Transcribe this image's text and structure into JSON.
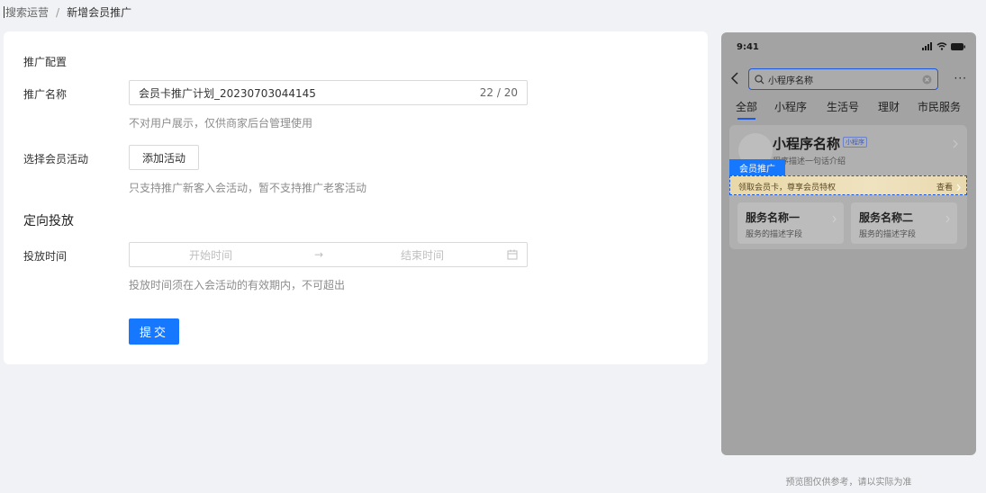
{
  "breadcrumb": {
    "prev": "搜索运营",
    "separator": "/",
    "current": "新增会员推广"
  },
  "form": {
    "section_title": "推广配置",
    "name_label": "推广名称",
    "name_value": "会员卡推广计划_20230703044145",
    "name_count": "22 / 20",
    "name_hint": "不对用户展示，仅供商家后台管理使用",
    "activity_label": "选择会员活动",
    "add_activity_button": "添加活动",
    "activity_hint": "只支持推广新客入会活动，暂不支持推广老客活动",
    "targeting_title": "定向投放",
    "time_label": "投放时间",
    "start_placeholder": "开始时间",
    "range_arrow": "→",
    "end_placeholder": "结束时间",
    "time_hint": "投放时间须在入会活动的有效期内，不可超出",
    "submit_button": "提交"
  },
  "preview": {
    "status_time": "9:41",
    "search_text": "小程序名称",
    "more": "···",
    "tabs": [
      "全部",
      "小程序",
      "生活号",
      "理财",
      "市民服务"
    ],
    "active_tab": 0,
    "mini_name": "小程序名称",
    "mini_tag": "小程序",
    "mini_desc": "程序描述一句话介绍",
    "promo_label": "会员推广",
    "promo_text": "领取会员卡，尊享会员特权",
    "promo_view": "查看",
    "services": [
      {
        "name": "服务名称一",
        "desc": "服务的描述字段"
      },
      {
        "name": "服务名称二",
        "desc": "服务的描述字段"
      }
    ],
    "note": "预览图仅供参考，请以实际为准"
  },
  "colors": {
    "primary": "#1677ff",
    "page_bg": "#f0f2f5",
    "phone_bg": "#a3a3a3"
  }
}
